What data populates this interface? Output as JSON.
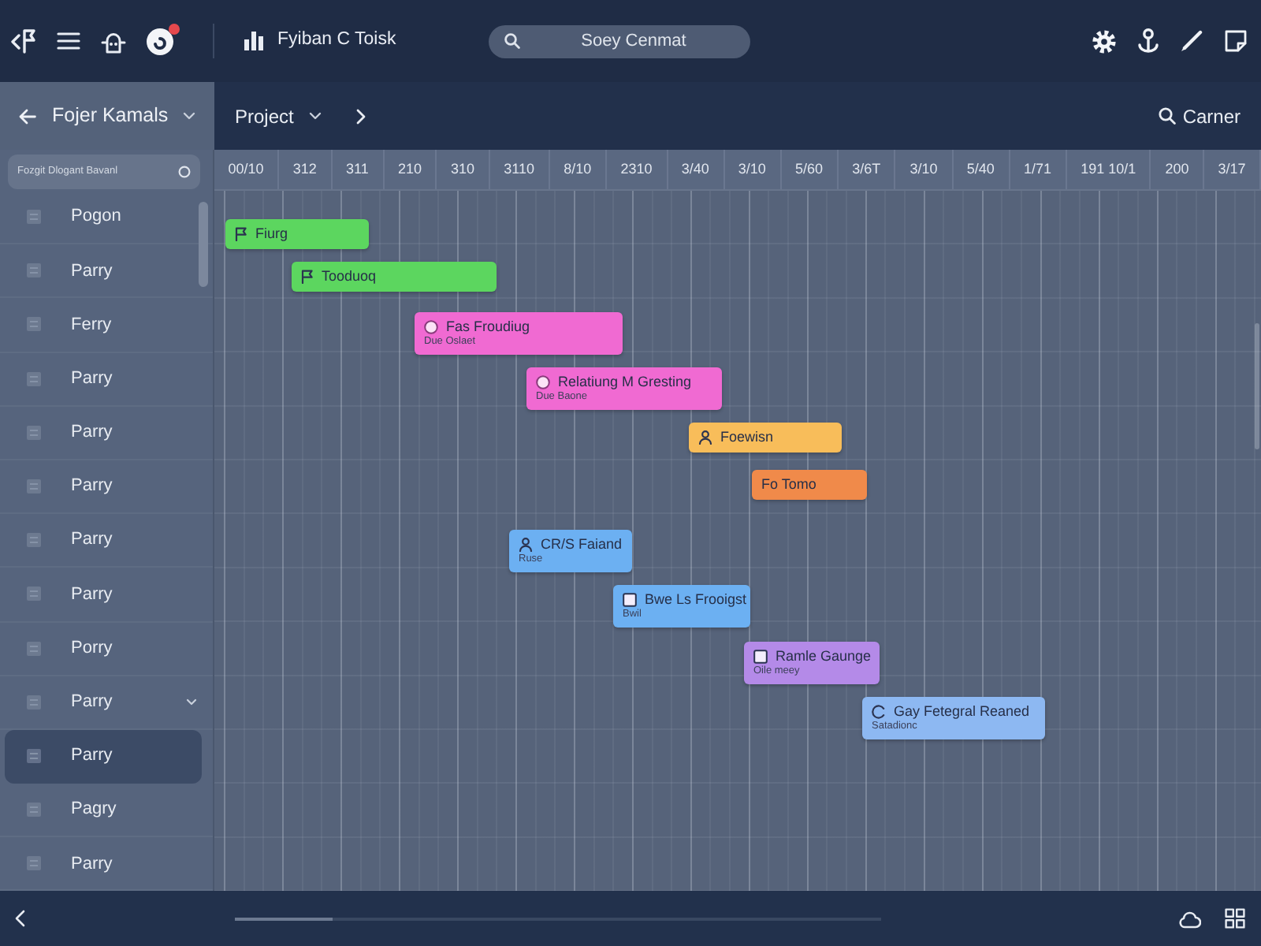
{
  "toolbar": {
    "title": "Fyiban C Toisk",
    "search": {
      "placeholder": "Soey Cenmat"
    }
  },
  "subheader": {
    "panel_title": "Fojer Kamals",
    "project_menu": "Project",
    "search_button": "Carner"
  },
  "sidebar": {
    "filter": {
      "value": "Fozgit Dlogant Bavanl"
    },
    "items": [
      {
        "label": "Pogon",
        "selected": false,
        "expandable": false
      },
      {
        "label": "Parry",
        "selected": false,
        "expandable": false
      },
      {
        "label": "Ferry",
        "selected": false,
        "expandable": false
      },
      {
        "label": "Parry",
        "selected": false,
        "expandable": false
      },
      {
        "label": "Parry",
        "selected": false,
        "expandable": false
      },
      {
        "label": "Parry",
        "selected": false,
        "expandable": false
      },
      {
        "label": "Parry",
        "selected": false,
        "expandable": false
      },
      {
        "label": "Parry",
        "selected": false,
        "expandable": false
      },
      {
        "label": "Porry",
        "selected": false,
        "expandable": false
      },
      {
        "label": "Parry",
        "selected": false,
        "expandable": true
      },
      {
        "label": "Parry",
        "selected": true,
        "expandable": false
      },
      {
        "label": "Pagry",
        "selected": false,
        "expandable": false
      },
      {
        "label": "Parry",
        "selected": false,
        "expandable": false
      }
    ]
  },
  "timeline": {
    "columns": [
      "00/10",
      "312",
      "311",
      "210",
      "310",
      "3110",
      "8/10",
      "2310",
      "3/40",
      "3/10",
      "5/60",
      "3/6T",
      "3/10",
      "5/40",
      "1/71",
      "191 10/1",
      "200",
      "3/17"
    ],
    "tasks": [
      {
        "label": "Fiurg",
        "color": "#5cd65f"
      },
      {
        "label": "Tooduoq",
        "color": "#5cd65f"
      },
      {
        "label": "Fas Froudiug",
        "sublabel": "Due Oslaet",
        "color": "#f06ad2"
      },
      {
        "label": "Relatiung M Gresting",
        "sublabel": "Due Baone",
        "color": "#f06ad2"
      },
      {
        "label": "Foewisn",
        "color": "#f8bd5a"
      },
      {
        "label": "Fo Tomo",
        "color": "#f08a4a"
      },
      {
        "label": "CR/S Faiand",
        "sublabel": "Ruse",
        "color": "#6cb0f2"
      },
      {
        "label": "Bwe Ls Frooigst",
        "sublabel": "Bwil",
        "color": "#6cb0f2"
      },
      {
        "label": "Ramle Gaunge",
        "sublabel": "Oile meey",
        "color": "#b48ae8"
      },
      {
        "label": "Gay Fetegral Reaned",
        "sublabel": "Satadionc",
        "color": "#8db8f2"
      }
    ]
  }
}
